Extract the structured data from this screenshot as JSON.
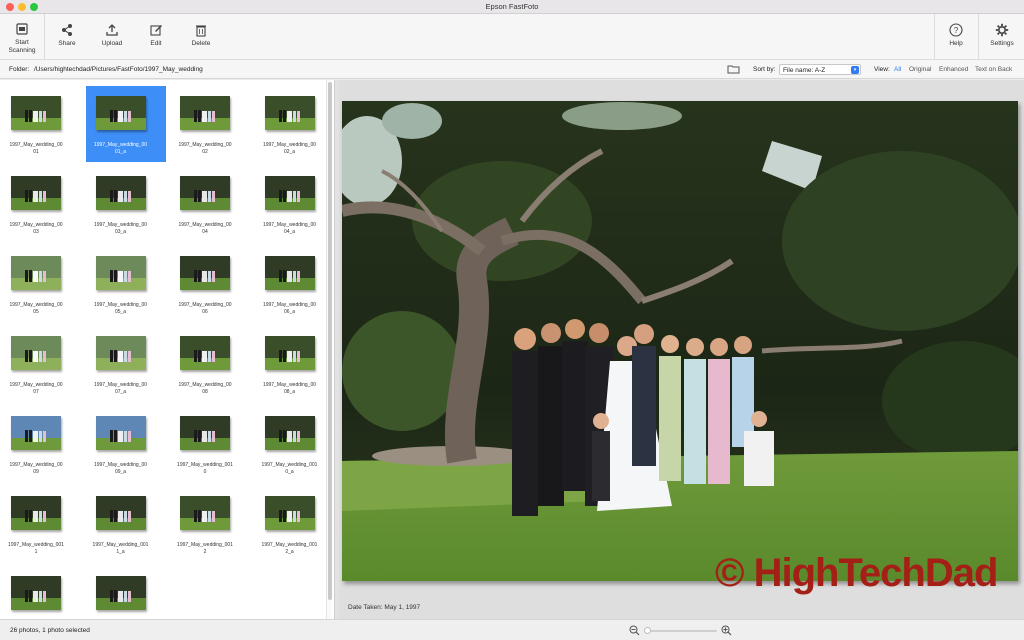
{
  "window": {
    "title": "Epson FastFoto"
  },
  "toolbar": {
    "start_scanning": "Start\nScanning",
    "share": "Share",
    "upload": "Upload",
    "edit": "Edit",
    "delete": "Delete",
    "help": "Help",
    "settings": "Settings"
  },
  "folderbar": {
    "label": "Folder:",
    "path": "/Users/hightechdad/Pictures/FastFoto/1997_May_wedding",
    "sort_label": "Sort by:",
    "sort_value": "File name: A-Z",
    "view_label": "View:",
    "view_options": [
      "All",
      "Original",
      "Enhanced",
      "Text on Back"
    ],
    "view_active": "All"
  },
  "thumbnails": [
    {
      "name": "1997_May_wedding_00\n01",
      "scene": "lawn"
    },
    {
      "name": "1997_May_wedding_00\n01_a",
      "scene": "lawn",
      "selected": true
    },
    {
      "name": "1997_May_wedding_00\n02",
      "scene": "lawn"
    },
    {
      "name": "1997_May_wedding_00\n02_a",
      "scene": "lawn"
    },
    {
      "name": "1997_May_wedding_00\n03",
      "scene": "arch"
    },
    {
      "name": "1997_May_wedding_00\n03_a",
      "scene": "arch"
    },
    {
      "name": "1997_May_wedding_00\n04",
      "scene": "arch"
    },
    {
      "name": "1997_May_wedding_00\n04_a",
      "scene": "arch"
    },
    {
      "name": "1997_May_wedding_00\n05",
      "scene": "bright"
    },
    {
      "name": "1997_May_wedding_00\n05_a",
      "scene": "bright"
    },
    {
      "name": "1997_May_wedding_00\n06",
      "scene": "arch"
    },
    {
      "name": "1997_May_wedding_00\n06_a",
      "scene": "arch"
    },
    {
      "name": "1997_May_wedding_00\n07",
      "scene": "bright"
    },
    {
      "name": "1997_May_wedding_00\n07_a",
      "scene": "bright"
    },
    {
      "name": "1997_May_wedding_00\n08",
      "scene": "lawn"
    },
    {
      "name": "1997_May_wedding_00\n08_a",
      "scene": "lawn"
    },
    {
      "name": "1997_May_wedding_00\n09",
      "scene": "sky"
    },
    {
      "name": "1997_May_wedding_00\n09_a",
      "scene": "sky"
    },
    {
      "name": "1997_May_wedding_001\n0",
      "scene": "arch"
    },
    {
      "name": "1997_May_wedding_001\n0_a",
      "scene": "arch"
    },
    {
      "name": "1997_May_wedding_001\n1",
      "scene": "arch"
    },
    {
      "name": "1997_May_wedding_001\n1_a",
      "scene": "arch"
    },
    {
      "name": "1997_May_wedding_001\n2",
      "scene": "lawn"
    },
    {
      "name": "1997_May_wedding_001\n2_a",
      "scene": "lawn"
    },
    {
      "name": "",
      "scene": "arch"
    },
    {
      "name": "",
      "scene": "arch"
    }
  ],
  "preview": {
    "date_taken": "Date Taken: May 1, 1997",
    "watermark": "© HighTechDad"
  },
  "status": {
    "text": "26 photos, 1 photo selected"
  },
  "colors": {
    "accent": "#2f7cf6",
    "selection": "#3d8ef7",
    "watermark": "#a41f16"
  },
  "icons": {
    "start_scanning": "scanner-icon",
    "share": "share-icon",
    "upload": "upload-icon",
    "edit": "edit-icon",
    "delete": "trash-icon",
    "help": "help-icon",
    "settings": "gear-icon",
    "folder": "folder-icon",
    "zoom_out": "zoom-out-icon",
    "zoom_in": "zoom-in-icon"
  }
}
